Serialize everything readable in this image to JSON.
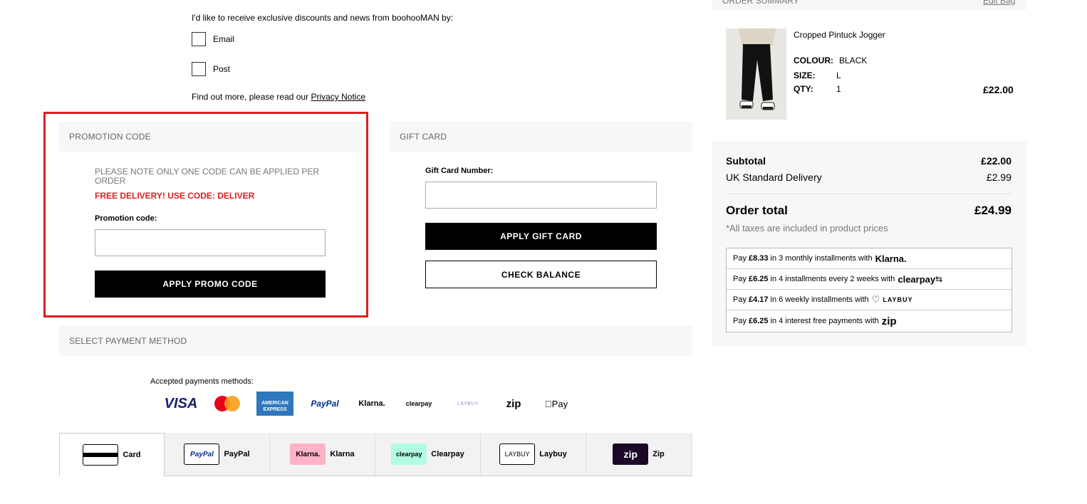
{
  "marketing": {
    "intro": "I'd like to receive exclusive discounts and news from boohooMAN by:",
    "options": [
      {
        "label": "Email",
        "checked": false
      },
      {
        "label": "Post",
        "checked": false
      }
    ],
    "privacy_prefix": "Find out more, please read our ",
    "privacy_link": "Privacy Notice"
  },
  "promo": {
    "header": "PROMOTION CODE",
    "note": "PLEASE NOTE ONLY ONE CODE CAN BE APPLIED PER ORDER",
    "free_delivery": "FREE DELIVERY! USE CODE: DELIVER",
    "field_label": "Promotion code:",
    "value": "",
    "button": "APPLY PROMO CODE",
    "highlight_color": "#d9201f"
  },
  "gift_card": {
    "header": "GIFT CARD",
    "field_label": "Gift Card Number:",
    "value": "",
    "apply_button": "APPLY GIFT CARD",
    "balance_button": "CHECK BALANCE"
  },
  "payment": {
    "header": "SELECT PAYMENT METHOD",
    "accepted_label": "Accepted payments methods:",
    "logos": [
      "VISA",
      "Mastercard",
      "AMERICAN EXPRESS",
      "PayPal",
      "Klarna.",
      "clearpay",
      "LAYBUY",
      "zip",
      "Pay"
    ],
    "tabs": [
      {
        "label": "Card",
        "icon": "card-icon",
        "icon_text": ""
      },
      {
        "label": "PayPal",
        "icon": "paypal-icon",
        "icon_text": "PayPal"
      },
      {
        "label": "Klarna",
        "icon": "klarna-icon",
        "icon_text": "Klarna."
      },
      {
        "label": "Clearpay",
        "icon": "clearpay-icon",
        "icon_text": "clearpay"
      },
      {
        "label": "Laybuy",
        "icon": "laybuy-icon",
        "icon_text": "LAYBUY"
      },
      {
        "label": "Zip",
        "icon": "zip-icon",
        "icon_text": "zip"
      }
    ],
    "active_tab": "Card"
  },
  "summary": {
    "title": "ORDER SUMMARY",
    "edit_link": "Edit Bag",
    "product": {
      "name": "Cropped Pintuck Jogger",
      "colour_label": "COLOUR:",
      "colour": "BLACK",
      "size_label": "SIZE:",
      "size": "L",
      "qty_label": "QTY:",
      "qty": "1",
      "price": "£22.00"
    },
    "subtotal_label": "Subtotal",
    "subtotal": "£22.00",
    "delivery_label": "UK Standard Delivery",
    "delivery": "£2.99",
    "total_label": "Order total",
    "total": "£24.99",
    "tax_note": "*All taxes are included in product prices",
    "bnpl": [
      {
        "pre": "Pay",
        "amount": "£8.33",
        "post": "in 3 monthly installments with",
        "brand": "Klarna."
      },
      {
        "pre": "Pay",
        "amount": "£6.25",
        "post": "in 4 installments every 2 weeks with",
        "brand": "clearpay"
      },
      {
        "pre": "Pay",
        "amount": "£4.17",
        "post": "in 6 weekly installments with",
        "brand": "LAYBUY"
      },
      {
        "pre": "Pay",
        "amount": "£6.25",
        "post": "in 4 interest free payments with",
        "brand": "zip"
      }
    ]
  }
}
